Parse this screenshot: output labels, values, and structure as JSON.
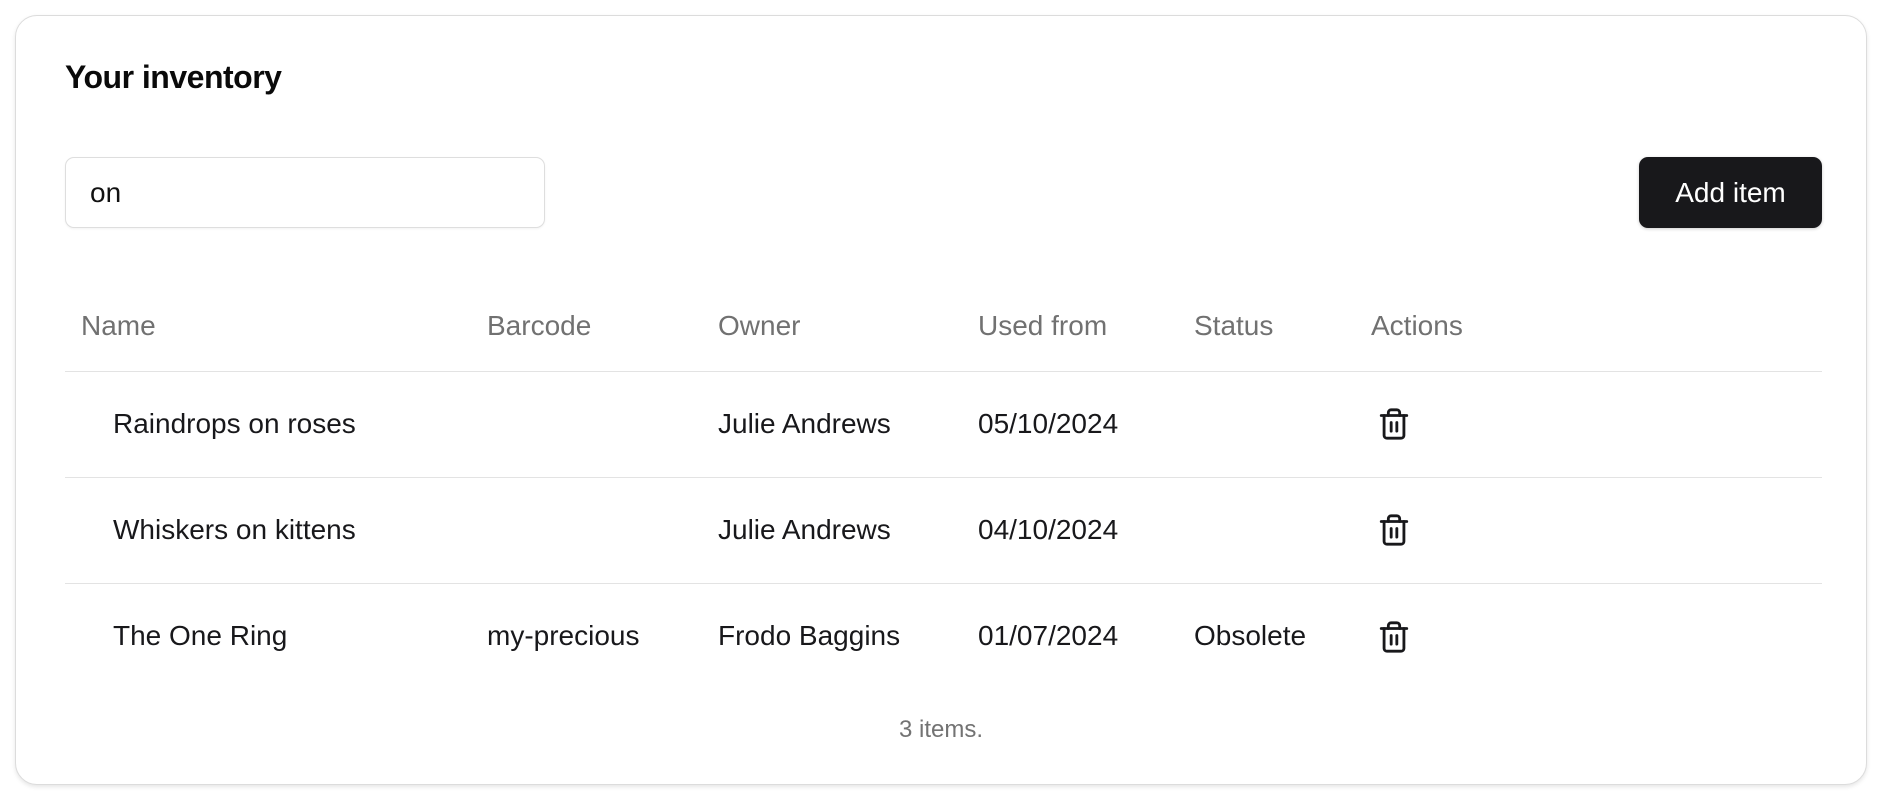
{
  "page": {
    "title": "Your inventory",
    "add_button_label": "Add item",
    "item_count_text": "3 items."
  },
  "search": {
    "value": "on"
  },
  "table": {
    "headers": {
      "name": "Name",
      "barcode": "Barcode",
      "owner": "Owner",
      "used_from": "Used from",
      "status": "Status",
      "actions": "Actions"
    },
    "rows": [
      {
        "name": "Raindrops on roses",
        "barcode": "",
        "owner": "Julie Andrews",
        "used_from": "05/10/2024",
        "status": "",
        "action_icon": "trash-icon"
      },
      {
        "name": "Whiskers on kittens",
        "barcode": "",
        "owner": "Julie Andrews",
        "used_from": "04/10/2024",
        "status": "",
        "action_icon": "trash-icon"
      },
      {
        "name": "The One Ring",
        "barcode": "my-precious",
        "owner": "Frodo Baggins",
        "used_from": "01/07/2024",
        "status": "Obsolete",
        "action_icon": "trash-icon"
      }
    ]
  },
  "colors": {
    "primary_button": "#18181b",
    "muted_text": "#717171",
    "border": "#e3e3e3"
  }
}
